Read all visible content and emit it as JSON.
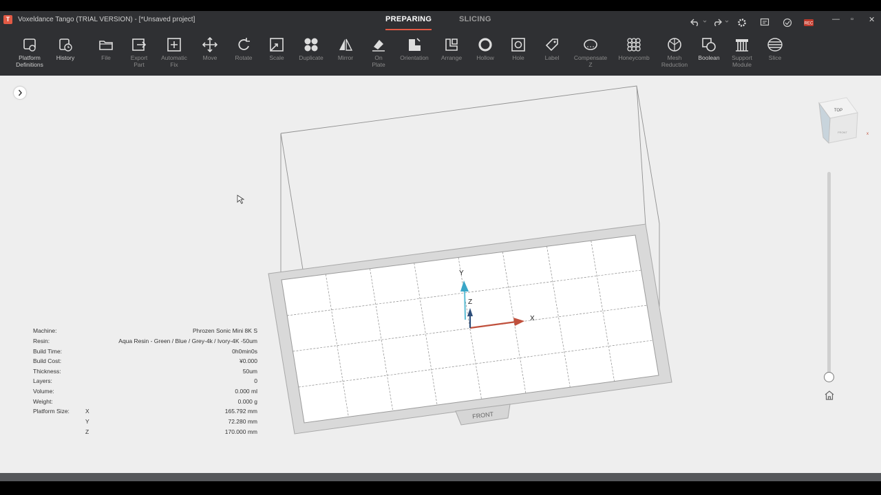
{
  "window": {
    "title": "Voxeldance Tango (TRIAL VERSION) - [*Unsaved project]",
    "app_icon": "T",
    "controls": {
      "minimize": "—",
      "maximize": "▫",
      "close": "✕"
    }
  },
  "modes": [
    {
      "label": "PREPARING",
      "active": true
    },
    {
      "label": "SLICING",
      "active": false
    }
  ],
  "topright_icons": [
    "undo-icon",
    "redo-icon",
    "settings-icon",
    "message-icon",
    "update-icon",
    "record-icon"
  ],
  "toolbar": {
    "tools": [
      {
        "name": "platform-definitions",
        "label": "Platform\nDefinitions",
        "icon": "platform-icon",
        "enabled": true
      },
      {
        "name": "history",
        "label": "History",
        "icon": "history-icon",
        "enabled": true
      },
      {
        "name": "file",
        "label": "File",
        "icon": "folder-icon",
        "enabled": false
      },
      {
        "name": "export-part",
        "label": "Export\nPart",
        "icon": "export-icon",
        "enabled": false
      },
      {
        "name": "automatic-fix",
        "label": "Automatic\nFix",
        "icon": "plus-box-icon",
        "enabled": false
      },
      {
        "name": "move",
        "label": "Move",
        "icon": "move-icon",
        "enabled": false
      },
      {
        "name": "rotate",
        "label": "Rotate",
        "icon": "rotate-icon",
        "enabled": false
      },
      {
        "name": "scale",
        "label": "Scale",
        "icon": "scale-icon",
        "enabled": false
      },
      {
        "name": "duplicate",
        "label": "Duplicate",
        "icon": "duplicate-icon",
        "enabled": false
      },
      {
        "name": "mirror",
        "label": "Mirror",
        "icon": "mirror-icon",
        "enabled": false
      },
      {
        "name": "on-plate",
        "label": "On\nPlate",
        "icon": "on-plate-icon",
        "enabled": false
      },
      {
        "name": "orientation",
        "label": "Orientation",
        "icon": "orientation-icon",
        "enabled": false
      },
      {
        "name": "arrange",
        "label": "Arrange",
        "icon": "arrange-icon",
        "enabled": false
      },
      {
        "name": "hollow",
        "label": "Hollow",
        "icon": "hollow-icon",
        "enabled": false
      },
      {
        "name": "hole",
        "label": "Hole",
        "icon": "hole-icon",
        "enabled": false
      },
      {
        "name": "label",
        "label": "Label",
        "icon": "label-icon",
        "enabled": false
      },
      {
        "name": "compensate-z",
        "label": "Compensate\nZ",
        "icon": "compensate-icon",
        "enabled": false
      },
      {
        "name": "honeycomb",
        "label": "Honeycomb",
        "icon": "honeycomb-icon",
        "enabled": false
      },
      {
        "name": "mesh-reduction",
        "label": "Mesh\nReduction",
        "icon": "mesh-reduction-icon",
        "enabled": false
      },
      {
        "name": "boolean",
        "label": "Boolean",
        "icon": "boolean-icon",
        "enabled": true
      },
      {
        "name": "support-module",
        "label": "Support\nModule",
        "icon": "support-icon",
        "enabled": false
      },
      {
        "name": "slice",
        "label": "Slice",
        "icon": "slice-icon",
        "enabled": false
      }
    ]
  },
  "info": {
    "rows": [
      {
        "key": "Machine:",
        "value": "Phrozen Sonic Mini 8K S"
      },
      {
        "key": "Resin:",
        "value": "Aqua Resin - Green / Blue / Grey-4k / Ivory-4K -50um"
      },
      {
        "key": "Build Time:",
        "value": "0h0min0s"
      },
      {
        "key": "Build Cost:",
        "value": "¥0.000"
      },
      {
        "key": "Thickness:",
        "value": "50um"
      },
      {
        "key": "Layers:",
        "value": "0"
      },
      {
        "key": "Volume:",
        "value": "0.000 ml"
      },
      {
        "key": "Weight:",
        "value": "0.000 g"
      },
      {
        "key": "Platform Size:",
        "axis": "X",
        "value": "165.792 mm"
      },
      {
        "key": "",
        "axis": "Y",
        "value": "72.280 mm"
      },
      {
        "key": "",
        "axis": "Z",
        "value": "170.000 mm"
      }
    ]
  },
  "scene": {
    "axis_labels": {
      "x": "X",
      "y": "Y",
      "z": "Z"
    },
    "front_label": "FRONT",
    "navcube_top": "TOP",
    "navcube_front": "FRONT",
    "navcube_x": "x"
  }
}
